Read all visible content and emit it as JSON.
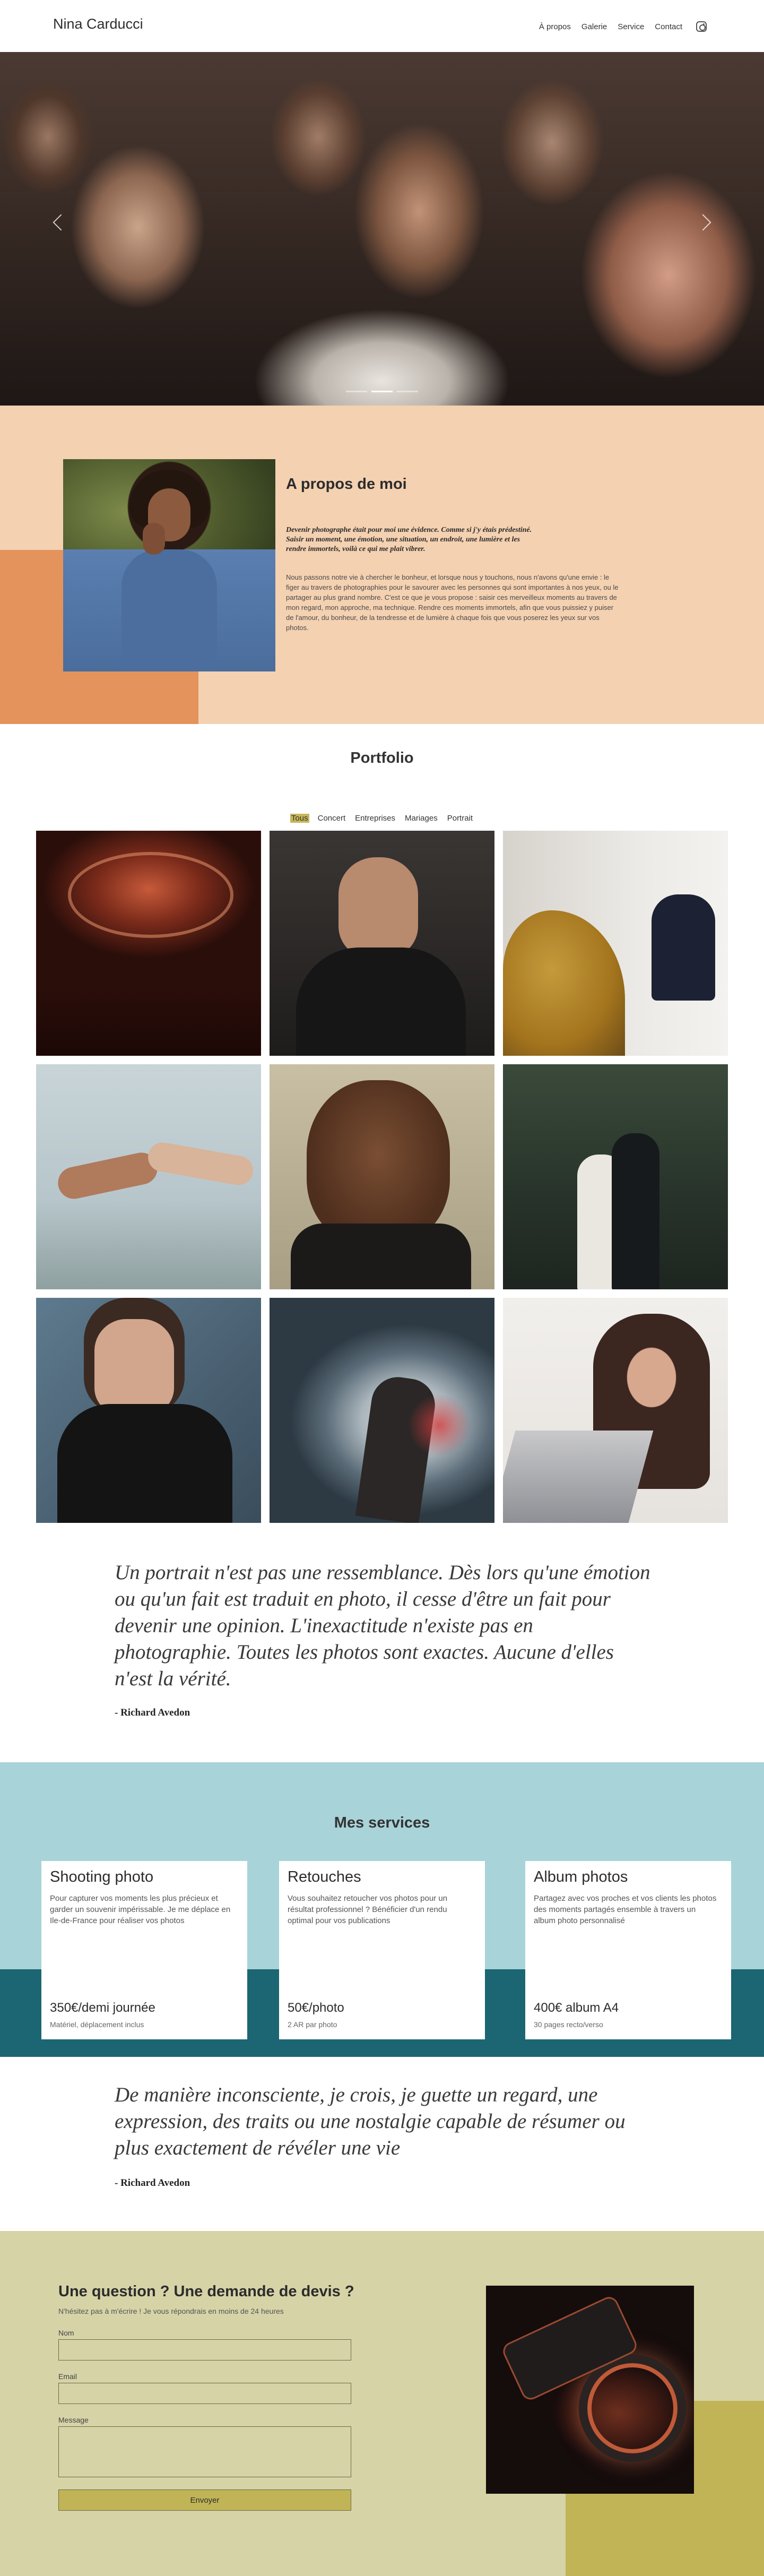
{
  "header": {
    "logo": "Nina Carducci",
    "nav": [
      "À propos",
      "Galerie",
      "Service",
      "Contact"
    ],
    "instagram_icon": "instagram-icon"
  },
  "hero": {
    "slides_count": 3,
    "active_slide": 2
  },
  "about": {
    "title": "A propos de moi",
    "quote": "Devenir photographe était pour moi une évidence. Comme si j'y étais prédestiné. Saisir un moment, une émotion, une situation, un endroit, une lumière et les rendre immortels, voilà ce qui me plait vibrer.",
    "text": "Nous passons notre vie à chercher le bonheur, et lorsque nous y touchons, nous n'avons qu'une envie : le figer au travers de photographies pour le savourer avec les personnes qui sont importantes à nos yeux, ou le partager au plus grand nombre. C'est ce que je vous propose : saisir ces merveilleux moments au travers de mon regard, mon approche, ma technique. Rendre ces moments immortels, afin que vous puissiez y puiser de l'amour, du bonheur, de la tendresse et de lumière à chaque fois que vous poserez les yeux sur vos photos."
  },
  "portfolio": {
    "title": "Portfolio",
    "filters": [
      "Tous",
      "Concert",
      "Entreprises",
      "Mariages",
      "Portrait"
    ],
    "active_filter": "Tous"
  },
  "quote1": {
    "text": "Un portrait n'est pas une ressemblance. Dès lors qu'une émotion ou qu'un fait est traduit en photo, il cesse d'être un fait pour devenir une opinion. L'inexactitude n'existe pas en photographie. Toutes les photos sont exactes. Aucune d'elles n'est la vérité.",
    "author": "- Richard Avedon"
  },
  "services": {
    "title": "Mes services",
    "cards": [
      {
        "title": "Shooting photo",
        "desc": "Pour capturer vos moments les plus précieux et garder un souvenir impérissable. Je me déplace en Ile-de-France pour réaliser vos photos",
        "price": "350€/demi journée",
        "note": "Matériel, déplacement inclus"
      },
      {
        "title": "Retouches",
        "desc": "Vous souhaitez retoucher vos photos pour un résultat professionnel ? Bénéficier d'un rendu optimal pour vos publications",
        "price": "50€/photo",
        "note": "2 AR par photo"
      },
      {
        "title": "Album photos",
        "desc": "Partagez avec vos proches et vos clients les photos des moments partagés ensemble à travers un album photo personnalisé",
        "price": "400€ album A4",
        "note": "30 pages recto/verso"
      }
    ]
  },
  "quote2": {
    "text": "De manière inconsciente, je crois, je guette un regard, une expression, des traits ou une nostalgie capable de résumer ou plus exactement de révéler une vie",
    "author": "- Richard Avedon"
  },
  "contact": {
    "title": "Une question ? Une demande de devis ?",
    "subtitle": "N'hésitez pas à m'écrire ! Je vous répondrais en moins de 24 heures",
    "labels": {
      "name": "Nom",
      "email": "Email",
      "message": "Message"
    },
    "values": {
      "name": "",
      "email": "",
      "message": ""
    },
    "submit": "Envoyer"
  }
}
